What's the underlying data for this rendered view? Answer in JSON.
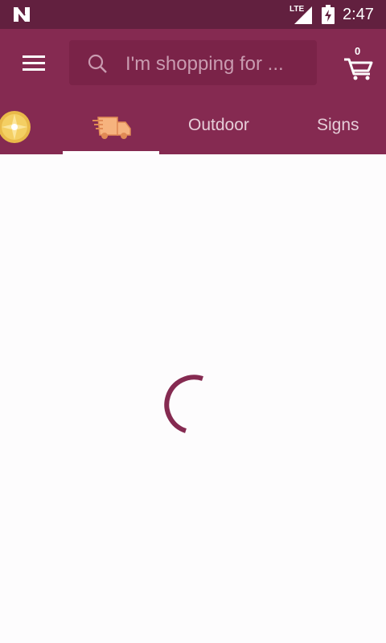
{
  "status_bar": {
    "network": "LTE",
    "time": "2:47"
  },
  "search": {
    "placeholder": "I'm shopping for ..."
  },
  "cart": {
    "count": "0"
  },
  "tabs": [
    {
      "label": "",
      "icon": "coin-icon"
    },
    {
      "label": "",
      "icon": "delivery-truck-icon",
      "selected": true
    },
    {
      "label": "Outdoor"
    },
    {
      "label": "Signs"
    }
  ],
  "colors": {
    "status_bar": "#62203f",
    "app_bar": "#852a51",
    "search_box": "#7a2348",
    "spinner": "#852a51",
    "background": "#fdfcfd"
  }
}
